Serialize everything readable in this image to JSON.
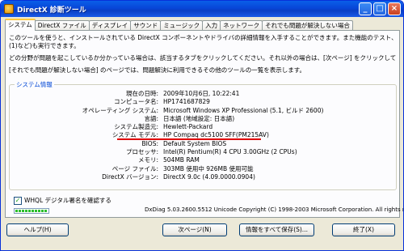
{
  "window": {
    "title": "DirectX 診断ツール",
    "minimize_glyph": "_",
    "maximize_glyph": "□",
    "close_glyph": "×"
  },
  "tabs": [
    {
      "label": "システム",
      "active": true
    },
    {
      "label": "DirectX ファイル",
      "active": false
    },
    {
      "label": "ディスプレイ",
      "active": false
    },
    {
      "label": "サウンド",
      "active": false
    },
    {
      "label": "ミュージック",
      "active": false
    },
    {
      "label": "入力",
      "active": false
    },
    {
      "label": "ネットワーク",
      "active": false
    },
    {
      "label": "それでも問題が解決しない場合",
      "active": false
    }
  ],
  "intro": {
    "line1": "このツールを使うと、インストールされている DirectX コンポーネントやドライバの詳細情報を入手することができます。また機能のテスト、問題の診断、システム構成の最",
    "line2": "(1)など)も実行できます。",
    "line3": "どの分野が問題を起こしているか分かっている場合は、該当するタブをクリックしてください。それ以外の場合は、[次ページ] をクリックしてください。",
    "line4": "[それでも問題が解決しない場合] のページでは、問題解決に利用できるその他のツールの一覧を表示します。"
  },
  "system_info": {
    "legend": "システム情報",
    "rows": [
      {
        "label": "現在の日時:",
        "value": "2009年10月6日, 10:22:41"
      },
      {
        "label": "コンピュータ名:",
        "value": "HP1741687829"
      },
      {
        "label": "オペレーティング システム:",
        "value": "Microsoft Windows XP Professional (5.1, ビルド 2600)"
      },
      {
        "label": "言語:",
        "value": "日本語 (地域設定: 日本語)"
      },
      {
        "label": "システム製造元:",
        "value": "Hewlett-Packard"
      },
      {
        "label": "システム モデル:",
        "value": "HP Compaq dc5100 SFF(PM215AV)"
      },
      {
        "label": "BIOS:",
        "value": "Default System BIOS"
      },
      {
        "label": "プロセッサ:",
        "value": "Intel(R) Pentium(R) 4 CPU 3.00GHz (2 CPUs)"
      },
      {
        "label": "メモリ:",
        "value": "504MB RAM"
      },
      {
        "label": "ページ ファイル:",
        "value": "303MB 使用中 926MB 使用可能"
      },
      {
        "label": "DirectX バージョン:",
        "value": "DirectX 9.0c (4.09.0000.0904)"
      }
    ],
    "highlight_color": "#e00000"
  },
  "whql": {
    "label": "WHQL デジタル署名を確認する",
    "checked": true,
    "check_glyph": "✓"
  },
  "progress": {
    "segments": 10,
    "color": "#2bbf2b"
  },
  "footer": {
    "copyright": "DxDiag 5.03.2600.5512 Unicode  Copyright (C) 1998-2003 Microsoft Corporation.  All rights reserved."
  },
  "buttons": {
    "help": "ヘルプ(H)",
    "next": "次ページ(N)",
    "save": "情報をすべて保存(S)...",
    "exit": "終了(X)"
  }
}
